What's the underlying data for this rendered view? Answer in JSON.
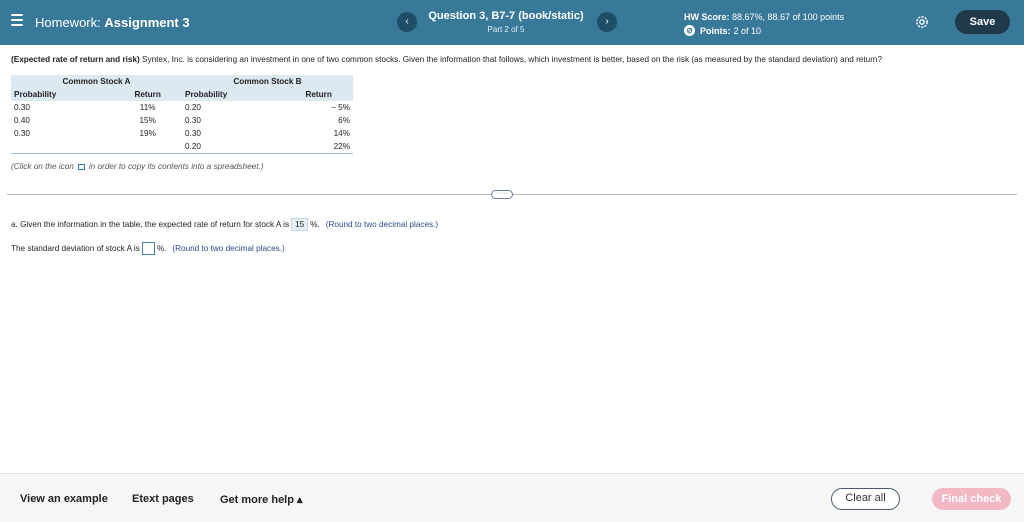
{
  "header": {
    "hw_prefix": "Homework: ",
    "hw_name": "Assignment 3",
    "question_title": "Question 3, B7-7 (book/static)",
    "question_part": "Part 2 of 5",
    "prev_icon": "‹",
    "next_icon": "›",
    "hw_score_label": "HW Score:",
    "hw_score_value": "88.67%, 88.67 of 100 points",
    "points_label": "Points:",
    "points_value": "2 of 10",
    "save_label": "Save",
    "colors": {
      "bar": "#38799a",
      "save": "#1f3a4a"
    }
  },
  "question": {
    "prompt_bold": "(Expected rate of return and risk)",
    "prompt_text": "Syntex, Inc. is considering an investment in one of two common stocks. Given the information that follows, which investment is better, based on the risk (as measured by the standard deviation) and return?",
    "table": {
      "group_a": "Common Stock A",
      "group_b": "Common Stock B",
      "col_prob": "Probability",
      "col_ret": "Return",
      "rows": [
        {
          "pa": "0.30",
          "ra": "11%",
          "pb": "0.20",
          "rb": "− 5%"
        },
        {
          "pa": "0.40",
          "ra": "15%",
          "pb": "0.30",
          "rb": "6%"
        },
        {
          "pa": "0.30",
          "ra": "19%",
          "pb": "0.30",
          "rb": "14%"
        },
        {
          "pa": "",
          "ra": "",
          "pb": "0.20",
          "rb": "22%"
        }
      ]
    },
    "copy_note_before": "(Click on the icon",
    "copy_note_after": "in order to copy its contents into a spreadsheet.)",
    "divider_handle": "·····"
  },
  "part_a": {
    "text": "a. Given the information in the table, the expected rate of return for stock A is",
    "answer": "15",
    "unit": "%.",
    "hint": "(Round to two decimal places.)"
  },
  "part_b": {
    "text": "The standard deviation of stock A is",
    "unit": "%.",
    "hint": "(Round to two decimal places.)",
    "value": ""
  },
  "footer": {
    "view_example": "View an example",
    "etext": "Etext pages",
    "more_help": "Get more help ▴",
    "clear_all": "Clear all",
    "final_check": "Final check"
  }
}
